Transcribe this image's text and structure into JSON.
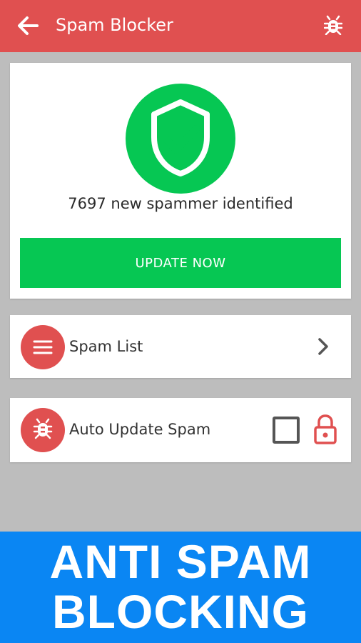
{
  "appbar": {
    "title": "Spam Blocker",
    "color": "#e05050",
    "icons": {
      "back": "back-arrow-icon",
      "action": "bug-icon"
    }
  },
  "status": {
    "icon": "shield-check-icon",
    "message": "7697 new spammer identified",
    "update_button": "UPDATE NOW",
    "accent": "#06c753"
  },
  "settings": [
    {
      "icon": "menu-icon",
      "label": "Spam List",
      "trailing": "chevron-right-icon"
    },
    {
      "icon": "bug-icon",
      "label": "Auto Update Spam",
      "checked": false,
      "trailing": "lock-icon"
    }
  ],
  "banner": {
    "line1": "ANTI SPAM",
    "line2": "BLOCKING",
    "color": "#0a86f3"
  }
}
